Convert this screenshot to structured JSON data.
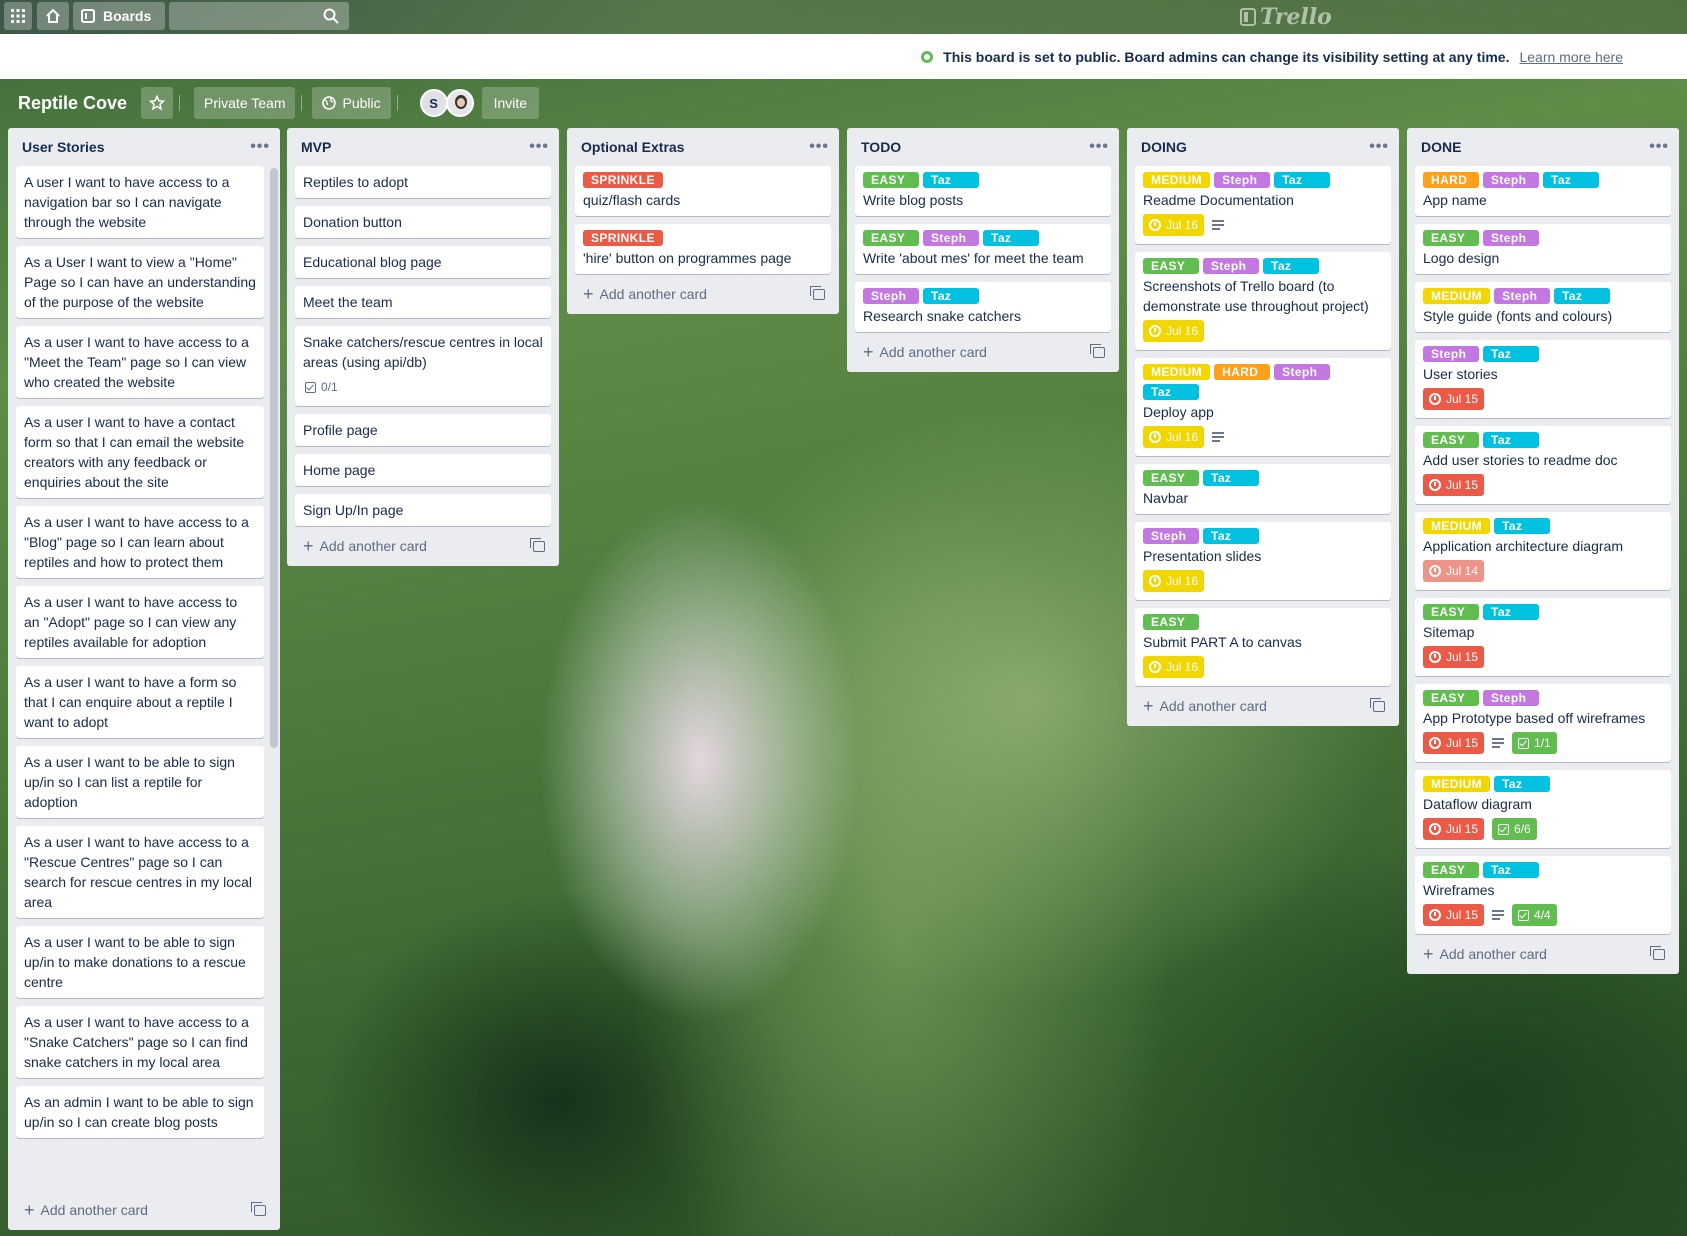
{
  "header": {
    "boards_label": "Boards",
    "logo_text": "Trello"
  },
  "banner": {
    "message": "This board is set to public. Board admins can change its visibility setting at any time.",
    "learn_more": "Learn more here"
  },
  "board": {
    "title": "Reptile Cove",
    "team": "Private Team",
    "visibility": "Public",
    "member_initial": "S",
    "invite": "Invite"
  },
  "colors": {
    "EASY": "#61bd4f",
    "MEDIUM": "#f2d600",
    "HARD": "#ff9f1a",
    "Steph": "#c377e0",
    "Taz": "#00c2e0",
    "SPRINKLE": "#eb5a46",
    "due_soon": "#f2d600",
    "overdue": "#eb5a46",
    "overdue_faded": "#ec9488"
  },
  "add_card_label": "Add another card",
  "lists": [
    {
      "title": "User Stories",
      "cards": [
        {
          "title": "A user I want to have access to a navigation bar so I can navigate through the website"
        },
        {
          "title": "As a User I want to view a \"Home\" Page so I can have an understanding of the purpose of the website"
        },
        {
          "title": "As a user I want to have access to a \"Meet the Team\" page so I can view who created the website"
        },
        {
          "title": "As a user I want to have a contact form so that I can email the website creators with any feedback or enquiries about the site"
        },
        {
          "title": "As a user I want to have access to a \"Blog\" page so I can learn about reptiles and how to protect them"
        },
        {
          "title": "As a user I want to have access to an \"Adopt\" page so I can view any reptiles available for adoption"
        },
        {
          "title": "As a user I want to have a form so that I can enquire about a reptile I want to adopt"
        },
        {
          "title": "As a user I want to be able to sign up/in so I can list a reptile for adoption"
        },
        {
          "title": "As a user I want to have access to a \"Rescue Centres\" page so I can search for rescue centres in my local area"
        },
        {
          "title": "As a user I want to be able to sign up/in to make donations to a rescue centre"
        },
        {
          "title": "As a user I want to have access to a \"Snake Catchers\" page so I can find snake catchers in my local area"
        },
        {
          "title": "As an admin I want to be able to sign up/in so I can create blog posts"
        }
      ]
    },
    {
      "title": "MVP",
      "cards": [
        {
          "title": "Reptiles to adopt"
        },
        {
          "title": "Donation button"
        },
        {
          "title": "Educational blog page"
        },
        {
          "title": "Meet the team"
        },
        {
          "title": "Snake catchers/rescue centres in local areas (using api/db)",
          "checklist": "0/1"
        },
        {
          "title": "Profile page"
        },
        {
          "title": "Home page"
        },
        {
          "title": "Sign Up/In page"
        }
      ]
    },
    {
      "title": "Optional Extras",
      "cards": [
        {
          "labels": [
            "SPRINKLE"
          ],
          "title": "quiz/flash cards"
        },
        {
          "labels": [
            "SPRINKLE"
          ],
          "title": "'hire' button on programmes page"
        }
      ]
    },
    {
      "title": "TODO",
      "cards": [
        {
          "labels": [
            "EASY",
            "Taz"
          ],
          "title": "Write blog posts"
        },
        {
          "labels": [
            "EASY",
            "Steph",
            "Taz"
          ],
          "title": "Write 'about mes' for meet the team"
        },
        {
          "labels": [
            "Steph",
            "Taz"
          ],
          "title": "Research snake catchers"
        }
      ]
    },
    {
      "title": "DOING",
      "cards": [
        {
          "labels": [
            "MEDIUM",
            "Steph",
            "Taz"
          ],
          "title": "Readme Documentation",
          "due": "Jul 16",
          "due_state": "soon",
          "desc": true
        },
        {
          "labels": [
            "EASY",
            "Steph",
            "Taz"
          ],
          "title": "Screenshots of Trello board (to demonstrate use throughout project)",
          "due": "Jul 16",
          "due_state": "soon"
        },
        {
          "labels": [
            "MEDIUM",
            "HARD",
            "Steph",
            "Taz"
          ],
          "title": "Deploy app",
          "due": "Jul 16",
          "due_state": "soon",
          "desc": true
        },
        {
          "labels": [
            "EASY",
            "Taz"
          ],
          "title": "Navbar"
        },
        {
          "labels": [
            "Steph",
            "Taz"
          ],
          "title": "Presentation slides",
          "due": "Jul 16",
          "due_state": "soon"
        },
        {
          "labels": [
            "EASY"
          ],
          "title": "Submit PART A to canvas",
          "due": "Jul 16",
          "due_state": "soon"
        }
      ]
    },
    {
      "title": "DONE",
      "cards": [
        {
          "labels": [
            "HARD",
            "Steph",
            "Taz"
          ],
          "title": "App name"
        },
        {
          "labels": [
            "EASY",
            "Steph"
          ],
          "title": "Logo design"
        },
        {
          "labels": [
            "MEDIUM",
            "Steph",
            "Taz"
          ],
          "title": "Style guide (fonts and colours)"
        },
        {
          "labels": [
            "Steph",
            "Taz"
          ],
          "title": "User stories",
          "due": "Jul 15",
          "due_state": "overdue"
        },
        {
          "labels": [
            "EASY",
            "Taz"
          ],
          "title": "Add user stories to readme doc",
          "due": "Jul 15",
          "due_state": "overdue"
        },
        {
          "labels": [
            "MEDIUM",
            "Taz"
          ],
          "title": "Application architecture diagram",
          "due": "Jul 14",
          "due_state": "faded"
        },
        {
          "labels": [
            "EASY",
            "Taz"
          ],
          "title": "Sitemap",
          "due": "Jul 15",
          "due_state": "overdue"
        },
        {
          "labels": [
            "EASY",
            "Steph"
          ],
          "title": "App Prototype based off wireframes",
          "due": "Jul 15",
          "due_state": "overdue",
          "desc": true,
          "checklist": "1/1",
          "checklist_done": true
        },
        {
          "labels": [
            "MEDIUM",
            "Taz"
          ],
          "title": "Dataflow diagram",
          "due": "Jul 15",
          "due_state": "overdue",
          "checklist": "6/6",
          "checklist_done": true
        },
        {
          "labels": [
            "EASY",
            "Taz"
          ],
          "title": "Wireframes",
          "due": "Jul 15",
          "due_state": "overdue",
          "desc": true,
          "checklist": "4/4",
          "checklist_done": true
        }
      ]
    }
  ]
}
